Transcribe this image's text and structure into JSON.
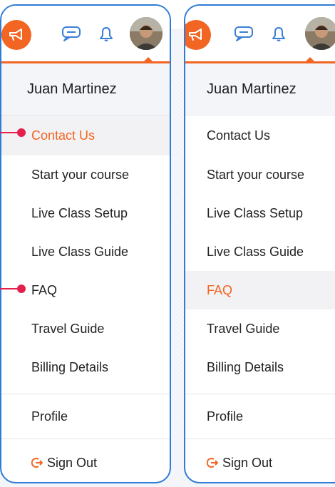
{
  "colors": {
    "accent": "#f26522",
    "frame": "#2f7bd6",
    "callout": "#e41f4b",
    "active_bg": "#f2f2f4"
  },
  "icons": {
    "megaphone": "megaphone-icon",
    "chat": "chat-icon",
    "bell": "bell-icon",
    "signout": "sign-out-icon"
  },
  "left": {
    "user_name": "Juan Martinez",
    "menu": [
      "Contact Us",
      "Start your course",
      "Live Class Setup",
      "Live Class Guide",
      "FAQ",
      "Travel Guide",
      "Billing Details"
    ],
    "active_item": "Contact Us",
    "profile": "Profile",
    "signout": "Sign Out"
  },
  "right": {
    "user_name": "Juan Martinez",
    "menu": [
      "Contact Us",
      "Start your course",
      "Live Class Setup",
      "Live Class Guide",
      "FAQ",
      "Travel Guide",
      "Billing Details"
    ],
    "active_item": "FAQ",
    "profile": "Profile",
    "signout": "Sign Out"
  }
}
